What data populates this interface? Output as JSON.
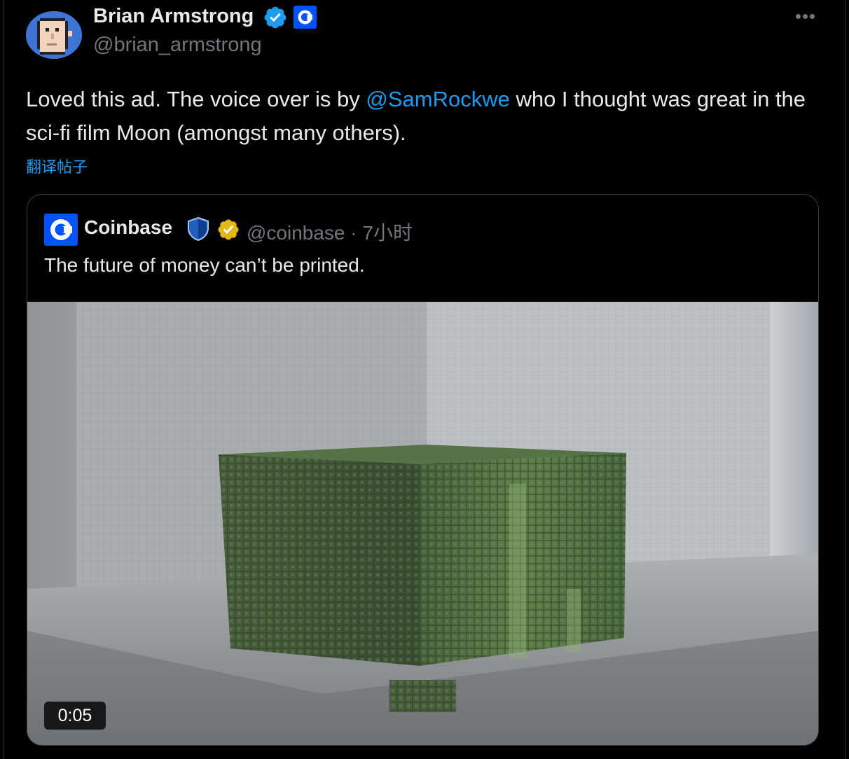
{
  "author": {
    "name": "Brian Armstrong",
    "handle": "@brian_armstrong",
    "avatar_icon": "pixel-punk-avatar",
    "verified_badge_color": "#1d9bf0",
    "affiliation_badge_icon": "coinbase-logo-icon"
  },
  "more_icon": "more-options-icon",
  "tweet": {
    "text_before_mention": "Loved this ad. The voice over is by ",
    "mention": "@SamRockwe",
    "text_after_mention": " who I thought was great in the sci-fi film Moon (amongst many others).",
    "translate_label": "翻译帖子"
  },
  "quoted_tweet": {
    "author_name": "Coinbase",
    "handle_time": "@coinbase · 7小时",
    "text": "The future of money can’t be printed.",
    "logo_color": "#0052ff",
    "verified_badge_color": "#e2b719",
    "media": {
      "type": "video-thumbnail",
      "description_icon": "green-pixel-cube-video",
      "duration": "0:05"
    }
  },
  "colors": {
    "background": "#000000",
    "text": "#e7e9ea",
    "secondary_text": "#71767b",
    "link": "#1d9bf0",
    "border": "#3a3f43"
  }
}
